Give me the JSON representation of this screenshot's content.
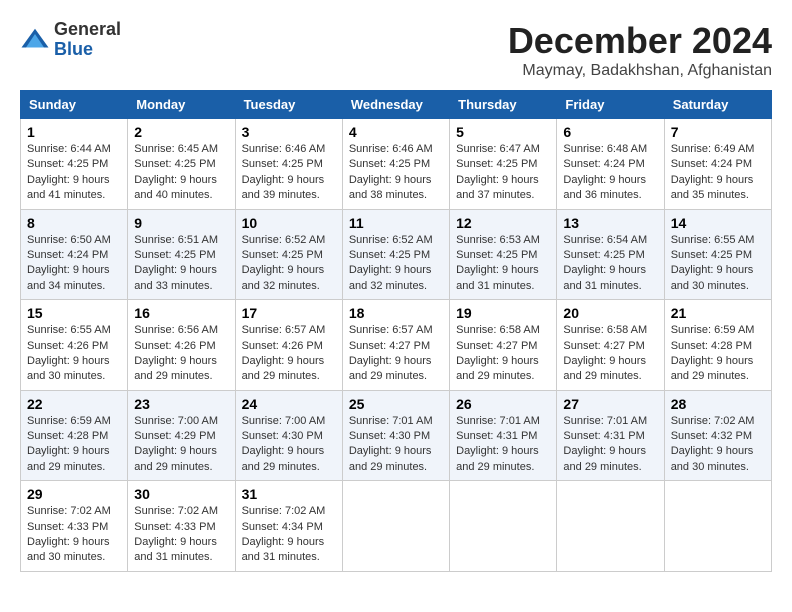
{
  "logo": {
    "general": "General",
    "blue": "Blue"
  },
  "title": "December 2024",
  "location": "Maymay, Badakhshan, Afghanistan",
  "days_of_week": [
    "Sunday",
    "Monday",
    "Tuesday",
    "Wednesday",
    "Thursday",
    "Friday",
    "Saturday"
  ],
  "weeks": [
    [
      {
        "day": "1",
        "sunrise": "Sunrise: 6:44 AM",
        "sunset": "Sunset: 4:25 PM",
        "daylight": "Daylight: 9 hours and 41 minutes."
      },
      {
        "day": "2",
        "sunrise": "Sunrise: 6:45 AM",
        "sunset": "Sunset: 4:25 PM",
        "daylight": "Daylight: 9 hours and 40 minutes."
      },
      {
        "day": "3",
        "sunrise": "Sunrise: 6:46 AM",
        "sunset": "Sunset: 4:25 PM",
        "daylight": "Daylight: 9 hours and 39 minutes."
      },
      {
        "day": "4",
        "sunrise": "Sunrise: 6:46 AM",
        "sunset": "Sunset: 4:25 PM",
        "daylight": "Daylight: 9 hours and 38 minutes."
      },
      {
        "day": "5",
        "sunrise": "Sunrise: 6:47 AM",
        "sunset": "Sunset: 4:25 PM",
        "daylight": "Daylight: 9 hours and 37 minutes."
      },
      {
        "day": "6",
        "sunrise": "Sunrise: 6:48 AM",
        "sunset": "Sunset: 4:24 PM",
        "daylight": "Daylight: 9 hours and 36 minutes."
      },
      {
        "day": "7",
        "sunrise": "Sunrise: 6:49 AM",
        "sunset": "Sunset: 4:24 PM",
        "daylight": "Daylight: 9 hours and 35 minutes."
      }
    ],
    [
      {
        "day": "8",
        "sunrise": "Sunrise: 6:50 AM",
        "sunset": "Sunset: 4:24 PM",
        "daylight": "Daylight: 9 hours and 34 minutes."
      },
      {
        "day": "9",
        "sunrise": "Sunrise: 6:51 AM",
        "sunset": "Sunset: 4:25 PM",
        "daylight": "Daylight: 9 hours and 33 minutes."
      },
      {
        "day": "10",
        "sunrise": "Sunrise: 6:52 AM",
        "sunset": "Sunset: 4:25 PM",
        "daylight": "Daylight: 9 hours and 32 minutes."
      },
      {
        "day": "11",
        "sunrise": "Sunrise: 6:52 AM",
        "sunset": "Sunset: 4:25 PM",
        "daylight": "Daylight: 9 hours and 32 minutes."
      },
      {
        "day": "12",
        "sunrise": "Sunrise: 6:53 AM",
        "sunset": "Sunset: 4:25 PM",
        "daylight": "Daylight: 9 hours and 31 minutes."
      },
      {
        "day": "13",
        "sunrise": "Sunrise: 6:54 AM",
        "sunset": "Sunset: 4:25 PM",
        "daylight": "Daylight: 9 hours and 31 minutes."
      },
      {
        "day": "14",
        "sunrise": "Sunrise: 6:55 AM",
        "sunset": "Sunset: 4:25 PM",
        "daylight": "Daylight: 9 hours and 30 minutes."
      }
    ],
    [
      {
        "day": "15",
        "sunrise": "Sunrise: 6:55 AM",
        "sunset": "Sunset: 4:26 PM",
        "daylight": "Daylight: 9 hours and 30 minutes."
      },
      {
        "day": "16",
        "sunrise": "Sunrise: 6:56 AM",
        "sunset": "Sunset: 4:26 PM",
        "daylight": "Daylight: 9 hours and 29 minutes."
      },
      {
        "day": "17",
        "sunrise": "Sunrise: 6:57 AM",
        "sunset": "Sunset: 4:26 PM",
        "daylight": "Daylight: 9 hours and 29 minutes."
      },
      {
        "day": "18",
        "sunrise": "Sunrise: 6:57 AM",
        "sunset": "Sunset: 4:27 PM",
        "daylight": "Daylight: 9 hours and 29 minutes."
      },
      {
        "day": "19",
        "sunrise": "Sunrise: 6:58 AM",
        "sunset": "Sunset: 4:27 PM",
        "daylight": "Daylight: 9 hours and 29 minutes."
      },
      {
        "day": "20",
        "sunrise": "Sunrise: 6:58 AM",
        "sunset": "Sunset: 4:27 PM",
        "daylight": "Daylight: 9 hours and 29 minutes."
      },
      {
        "day": "21",
        "sunrise": "Sunrise: 6:59 AM",
        "sunset": "Sunset: 4:28 PM",
        "daylight": "Daylight: 9 hours and 29 minutes."
      }
    ],
    [
      {
        "day": "22",
        "sunrise": "Sunrise: 6:59 AM",
        "sunset": "Sunset: 4:28 PM",
        "daylight": "Daylight: 9 hours and 29 minutes."
      },
      {
        "day": "23",
        "sunrise": "Sunrise: 7:00 AM",
        "sunset": "Sunset: 4:29 PM",
        "daylight": "Daylight: 9 hours and 29 minutes."
      },
      {
        "day": "24",
        "sunrise": "Sunrise: 7:00 AM",
        "sunset": "Sunset: 4:30 PM",
        "daylight": "Daylight: 9 hours and 29 minutes."
      },
      {
        "day": "25",
        "sunrise": "Sunrise: 7:01 AM",
        "sunset": "Sunset: 4:30 PM",
        "daylight": "Daylight: 9 hours and 29 minutes."
      },
      {
        "day": "26",
        "sunrise": "Sunrise: 7:01 AM",
        "sunset": "Sunset: 4:31 PM",
        "daylight": "Daylight: 9 hours and 29 minutes."
      },
      {
        "day": "27",
        "sunrise": "Sunrise: 7:01 AM",
        "sunset": "Sunset: 4:31 PM",
        "daylight": "Daylight: 9 hours and 29 minutes."
      },
      {
        "day": "28",
        "sunrise": "Sunrise: 7:02 AM",
        "sunset": "Sunset: 4:32 PM",
        "daylight": "Daylight: 9 hours and 30 minutes."
      }
    ],
    [
      {
        "day": "29",
        "sunrise": "Sunrise: 7:02 AM",
        "sunset": "Sunset: 4:33 PM",
        "daylight": "Daylight: 9 hours and 30 minutes."
      },
      {
        "day": "30",
        "sunrise": "Sunrise: 7:02 AM",
        "sunset": "Sunset: 4:33 PM",
        "daylight": "Daylight: 9 hours and 31 minutes."
      },
      {
        "day": "31",
        "sunrise": "Sunrise: 7:02 AM",
        "sunset": "Sunset: 4:34 PM",
        "daylight": "Daylight: 9 hours and 31 minutes."
      },
      null,
      null,
      null,
      null
    ]
  ]
}
